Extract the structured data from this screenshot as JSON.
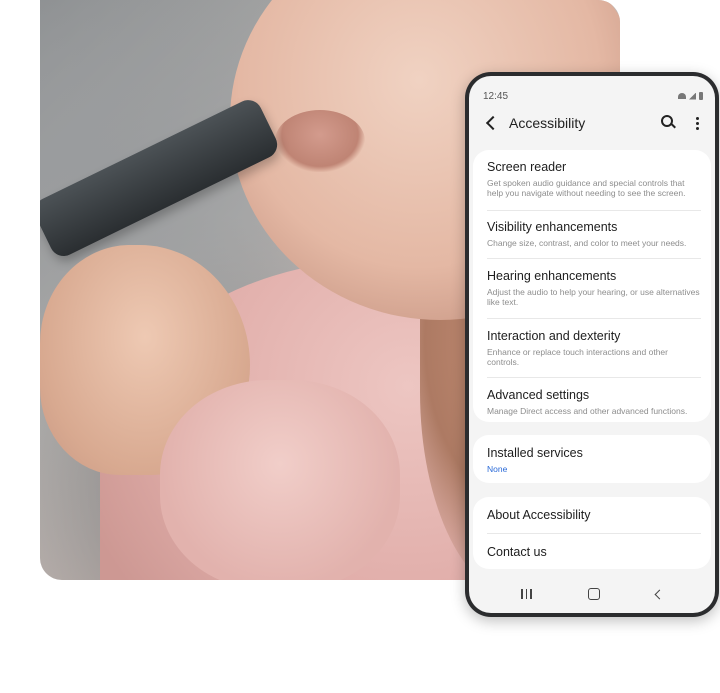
{
  "status": {
    "time": "12:45"
  },
  "appbar": {
    "title": "Accessibility"
  },
  "settings": {
    "items": [
      {
        "title": "Screen reader",
        "desc": "Get spoken audio guidance and special controls that help you navigate without needing to see the screen."
      },
      {
        "title": "Visibility enhancements",
        "desc": "Change size, contrast, and color to meet your needs."
      },
      {
        "title": "Hearing enhancements",
        "desc": "Adjust the audio to help your hearing, or use alternatives like text."
      },
      {
        "title": "Interaction and dexterity",
        "desc": "Enhance or replace touch interactions and other controls."
      },
      {
        "title": "Advanced settings",
        "desc": "Manage Direct access and other advanced functions."
      }
    ],
    "installed": {
      "title": "Installed services",
      "value": "None"
    },
    "about": {
      "title": "About Accessibility"
    },
    "contact": {
      "title": "Contact us"
    }
  },
  "colors": {
    "accent": "#2a6ad8",
    "card": "#ffffff",
    "screen_bg": "#f4f4f4",
    "frame": "#2b2c2e"
  }
}
